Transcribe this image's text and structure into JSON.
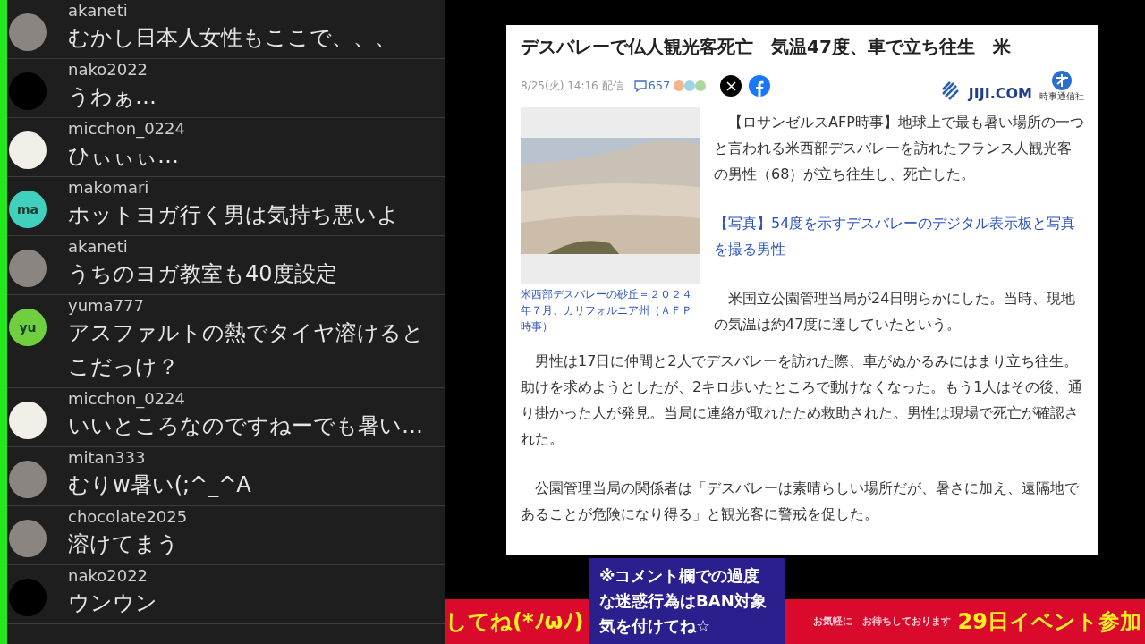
{
  "chat": {
    "comments": [
      {
        "user": "akaneti",
        "avatar": {
          "kind": "photo"
        },
        "message": "むかし日本人女性もここで、、、"
      },
      {
        "user": "nako2022",
        "avatar": {
          "kind": "dark"
        },
        "message": "うわぁ…"
      },
      {
        "user": "micchon_0224",
        "avatar": {
          "kind": "light"
        },
        "message": "ひぃぃぃ…"
      },
      {
        "user": "makomari",
        "avatar": {
          "kind": "initials",
          "initials": "ma",
          "color": "#3fd1bd"
        },
        "message": "ホットヨガ行く男は気持ち悪いよ"
      },
      {
        "user": "akaneti",
        "avatar": {
          "kind": "photo"
        },
        "message": "うちのヨガ教室も40度設定"
      },
      {
        "user": "yuma777",
        "avatar": {
          "kind": "initials",
          "initials": "yu",
          "color": "#6fcf3f"
        },
        "message": "アスファルトの熱でタイヤ溶けるとこだっけ？"
      },
      {
        "user": "micchon_0224",
        "avatar": {
          "kind": "light"
        },
        "message": "いいところなのですねーでも暑い…"
      },
      {
        "user": "mitan333",
        "avatar": {
          "kind": "photo"
        },
        "message": "むりw暑い(;^_^A"
      },
      {
        "user": "chocolate2025",
        "avatar": {
          "kind": "photo"
        },
        "message": "溶けてまう"
      },
      {
        "user": "nako2022",
        "avatar": {
          "kind": "dark"
        },
        "message": "ウンウン"
      }
    ]
  },
  "article": {
    "title": "デスバレーで仏人観光客死亡　気温47度、車で立ち往生　米",
    "date": "8/25(火) 14:16 配信",
    "comment_count": "657",
    "source": {
      "logo_text": "JIJI.COM",
      "publisher": "時事通信社"
    },
    "image_caption": "米西部デスバレーの砂丘＝２０２４年７月、カリフォルニア州（ＡＦＰ時事）",
    "side_blocks": [
      {
        "kind": "paragraph",
        "text": "【ロサンゼルスAFP時事】地球上で最も暑い場所の一つと言われる米西部デスバレーを訪れたフランス人観光客の男性（68）が立ち往生し、死亡した。"
      },
      {
        "kind": "link",
        "text": "【写真】54度を示すデスバレーのデジタル表示板と写真を撮る男性"
      },
      {
        "kind": "paragraph",
        "text": "米国立公園管理当局が24日明らかにした。当時、現地の気温は約47度に達していたという。"
      }
    ],
    "paragraphs": [
      "男性は17日に仲間と2人でデスバレーを訪れた際、車がぬかるみにはまり立ち往生。助けを求めようとしたが、2キロ歩いたところで動けなくなった。もう1人はその後、通り掛かった人が発見。当局に連絡が取れたため救助された。男性は現場で死亡が確認された。",
      "公園管理当局の関係者は「デスバレーは素晴らしい場所だが、暑さに加え、遠隔地であることが危険になり得る」と観光客に警戒を促した。"
    ]
  },
  "overlay": {
    "notice": "※コメント欄での過度な迷惑行為はBAN対象気を付けてね☆",
    "ticker_left": "してね(*ﾉωﾉ)",
    "ticker_faint": "お気軽に　お待ちしております",
    "ticker_right": "29日イベント参加"
  }
}
